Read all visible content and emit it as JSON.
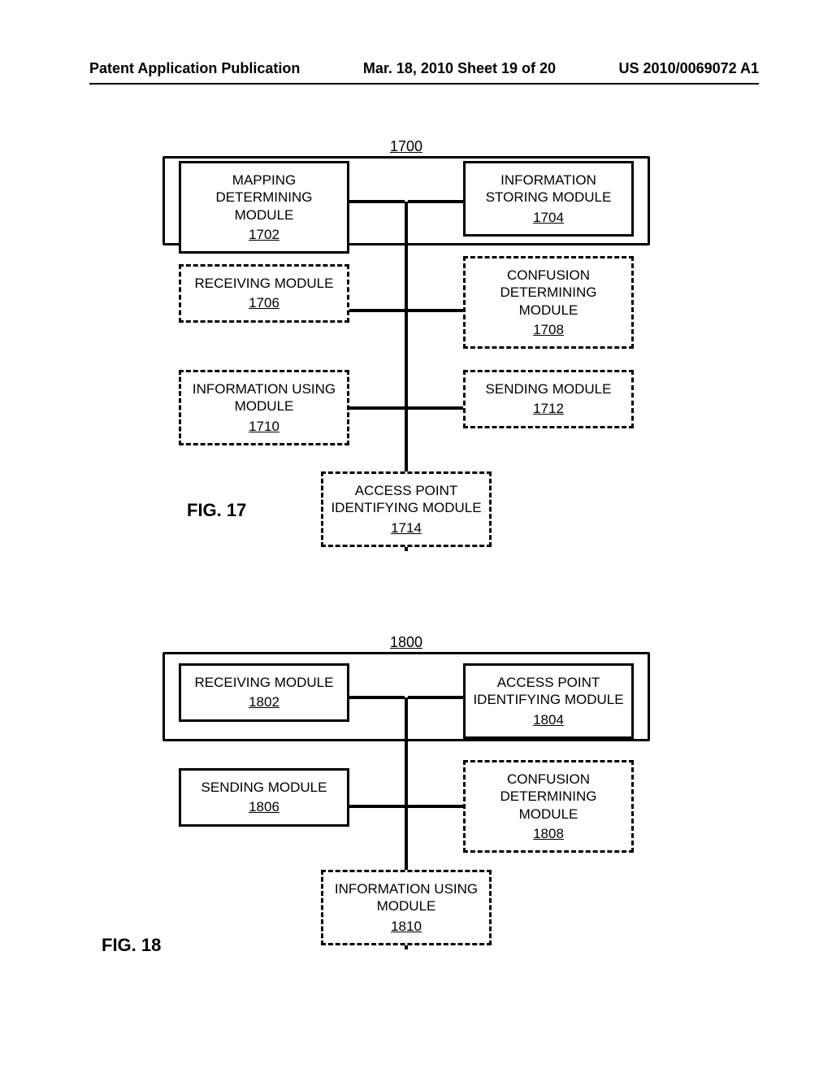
{
  "header": {
    "left": "Patent Application Publication",
    "center": "Mar. 18, 2010  Sheet 19 of 20",
    "right": "US 2010/0069072 A1"
  },
  "fig17": {
    "number": "1700",
    "label": "FIG. 17",
    "boxes": {
      "b1702": {
        "title": "MAPPING DETERMINING MODULE",
        "ref": "1702"
      },
      "b1704": {
        "title": "INFORMATION STORING MODULE",
        "ref": "1704"
      },
      "b1706": {
        "title": "RECEIVING MODULE",
        "ref": "1706"
      },
      "b1708": {
        "title": "CONFUSION DETERMINING MODULE",
        "ref": "1708"
      },
      "b1710": {
        "title": "INFORMATION USING MODULE",
        "ref": "1710"
      },
      "b1712": {
        "title": "SENDING MODULE",
        "ref": "1712"
      },
      "b1714": {
        "title": "ACCESS POINT IDENTIFYING MODULE",
        "ref": "1714"
      }
    }
  },
  "fig18": {
    "number": "1800",
    "label": "FIG. 18",
    "boxes": {
      "b1802": {
        "title": "RECEIVING MODULE",
        "ref": "1802"
      },
      "b1804": {
        "title": "ACCESS POINT IDENTIFYING MODULE",
        "ref": "1804"
      },
      "b1806": {
        "title": "SENDING MODULE",
        "ref": "1806"
      },
      "b1808": {
        "title": "CONFUSION DETERMINING MODULE",
        "ref": "1808"
      },
      "b1810": {
        "title": "INFORMATION USING MODULE",
        "ref": "1810"
      }
    }
  }
}
